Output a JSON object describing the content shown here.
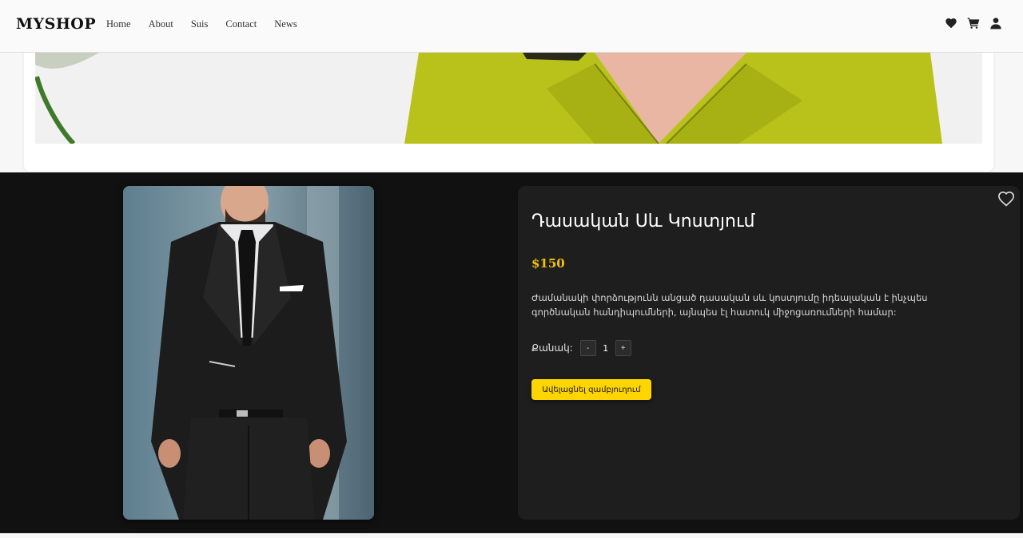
{
  "header": {
    "logo": "MYSHOP",
    "nav": [
      "Home",
      "About",
      "Suis",
      "Contact",
      "News"
    ],
    "icons": [
      "heart-icon",
      "cart-icon",
      "user-icon"
    ]
  },
  "product": {
    "title": "Դասական Սև Կոստյում",
    "price": "$150",
    "description": "Ժամանակի փորձությունն անցած դասական սև կոստյումը իդեալական է ինչպես գործնական հանդիպումների, այնպես էլ հատուկ միջոցառումների համար:",
    "quantity_label": "Քանակ:",
    "decrement_label": "-",
    "quantity": "1",
    "increment_label": "+",
    "add_to_cart_label": "Ավելացնել զամբյուղում",
    "favorite_icon": "heart-outline-icon"
  },
  "colors": {
    "accent": "#f5c400",
    "button": "#ffd500",
    "section_bg": "#111111",
    "card_bg": "#1e1e1e",
    "coat": "#b8c21a"
  }
}
